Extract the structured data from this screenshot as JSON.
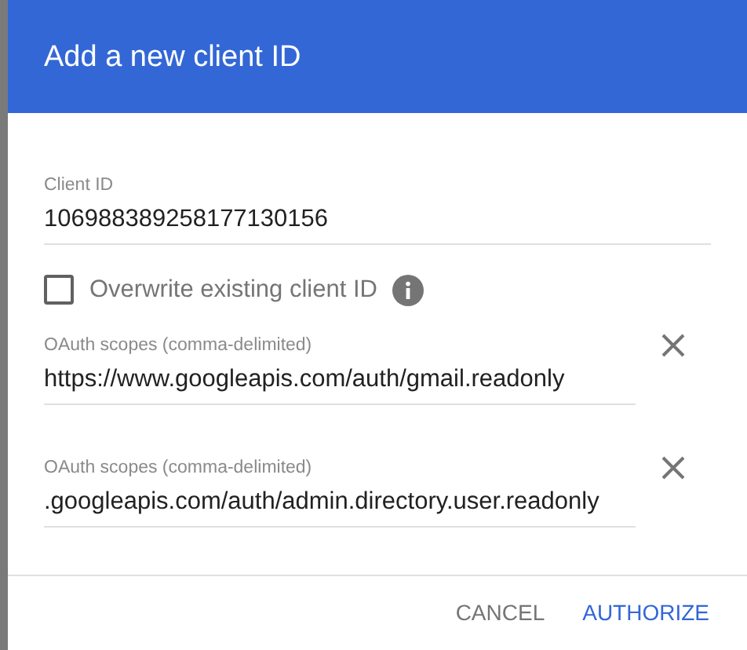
{
  "dialog": {
    "title": "Add a new client ID",
    "client_id": {
      "label": "Client ID",
      "value": "106988389258177130156"
    },
    "overwrite": {
      "label": "Overwrite existing client ID",
      "checked": false
    },
    "scopes": [
      {
        "label": "OAuth scopes (comma-delimited)",
        "value": "https://www.googleapis.com/auth/gmail.readonly"
      },
      {
        "label": "OAuth scopes (comma-delimited)",
        "value": ".googleapis.com/auth/admin.directory.user.readonly"
      }
    ],
    "buttons": [
      {
        "label": "CANCEL",
        "kind": "secondary"
      },
      {
        "label": "AUTHORIZE",
        "kind": "primary"
      }
    ]
  }
}
